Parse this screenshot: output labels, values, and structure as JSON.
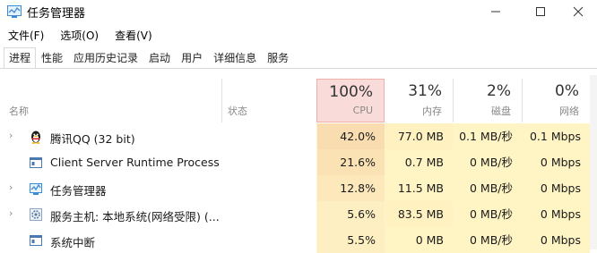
{
  "window": {
    "title": "任务管理器",
    "minimize": "—",
    "maximize": "☐",
    "close": "✕"
  },
  "menu": [
    "文件(F)",
    "选项(O)",
    "查看(V)"
  ],
  "tabs": [
    "进程",
    "性能",
    "应用历史记录",
    "启动",
    "用户",
    "详细信息",
    "服务"
  ],
  "columns": {
    "name": "名称",
    "status": "状态",
    "cpu": {
      "pct": "100%",
      "label": "CPU"
    },
    "memory": {
      "pct": "31%",
      "label": "内存"
    },
    "disk": {
      "pct": "2%",
      "label": "磁盘"
    },
    "network": {
      "pct": "0%",
      "label": "网络"
    }
  },
  "rows": [
    {
      "name": "腾讯QQ (32 bit)",
      "cpu": "42.0%",
      "memory": "77.0 MB",
      "disk": "0.1 MB/秒",
      "network": "0.1 Mbps",
      "expand": "›",
      "icon": "qq-penguin-icon"
    },
    {
      "name": "Client Server Runtime Process",
      "cpu": "21.6%",
      "memory": "0.7 MB",
      "disk": "0 MB/秒",
      "network": "0 Mbps",
      "expand": "",
      "icon": "window-icon"
    },
    {
      "name": "任务管理器",
      "cpu": "12.8%",
      "memory": "11.5 MB",
      "disk": "0 MB/秒",
      "network": "0 Mbps",
      "expand": "›",
      "icon": "task-manager-icon"
    },
    {
      "name": "服务主机: 本地系统(网络受限) (...",
      "cpu": "5.6%",
      "memory": "83.5 MB",
      "disk": "0 MB/秒",
      "network": "0 Mbps",
      "expand": "›",
      "icon": "gear-icon"
    },
    {
      "name": "系统中断",
      "cpu": "5.5%",
      "memory": "0 MB",
      "disk": "0 MB/秒",
      "network": "0 Mbps",
      "expand": "",
      "icon": "window-icon"
    }
  ],
  "colors": {
    "cpu_high": "#f9dcb0",
    "cpu_mid": "#fbe7b7",
    "cell_light": "#fff4c4",
    "cpu_header": "#f9dcd9"
  }
}
